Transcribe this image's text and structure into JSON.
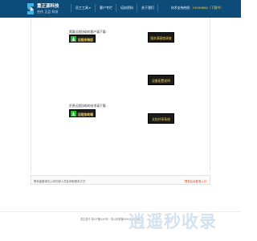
{
  "header": {
    "logo_name": "重正源科技",
    "logo_sub": "合作 正品 科技",
    "nav": [
      {
        "label": "员工工具",
        "has_caret": true
      },
      {
        "label": "客户专栏"
      },
      {
        "label": "培训资料"
      },
      {
        "label": "关于我们"
      }
    ],
    "hotline_label": "技术支持热线：",
    "hotline_number": "15099880（下载中）"
  },
  "downloads": {
    "prompt_1": "需要远程协助的客户请下载:",
    "button_1": "远程安装版",
    "prompt_2": "负责远程协助的技术请下载:",
    "button_2": "远程协助端"
  },
  "side_buttons": [
    {
      "label": "服务满意度调查"
    },
    {
      "label": "设备配置说明"
    },
    {
      "label": "文档共享系统"
    }
  ],
  "footer": {
    "note": "联系客服请在公司内部人员处获取联系方式",
    "link": "预览后台登录入口"
  },
  "copyright": "",
  "beian": "重正源子 粤ICP备XXX号 · 粤公网安备XXXXXXXX号",
  "watermark": "逍遥秒收录",
  "colors": {
    "header_bg": "#0d4b78",
    "button_bg": "#1f1f1f",
    "button_text": "#ffd84a",
    "link": "#d0421b"
  }
}
